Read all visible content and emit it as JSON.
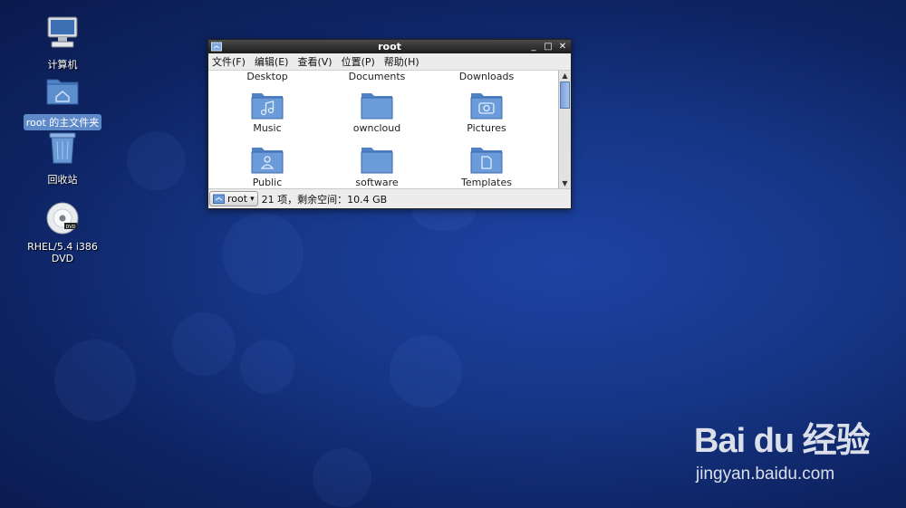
{
  "desktop": {
    "icons": [
      {
        "label": "计算机"
      },
      {
        "label": "root 的主文件夹"
      },
      {
        "label": "回收站"
      },
      {
        "label": "RHEL/5.4 i386 DVD"
      }
    ],
    "dvd_badge": "DVD"
  },
  "window": {
    "title": "root",
    "controls": {
      "minimize": "_",
      "maximize": "□",
      "close": "✕"
    },
    "menu": [
      "文件(F)",
      "编辑(E)",
      "查看(V)",
      "位置(P)",
      "帮助(H)"
    ],
    "files": [
      {
        "name": "Desktop"
      },
      {
        "name": "Documents"
      },
      {
        "name": "Downloads"
      },
      {
        "name": "Music"
      },
      {
        "name": "owncloud"
      },
      {
        "name": "Pictures"
      },
      {
        "name": "Public"
      },
      {
        "name": "software"
      },
      {
        "name": "Templates"
      }
    ],
    "status": {
      "location": "root",
      "info": "21 项，剩余空间：10.4 GB"
    }
  },
  "watermark": {
    "logo": "Bai du 经验",
    "url": "jingyan.baidu.com"
  },
  "colors": {
    "desktop_bg": "#163687",
    "folder": "#5d8fcf",
    "selection": "#5f8ac9"
  }
}
